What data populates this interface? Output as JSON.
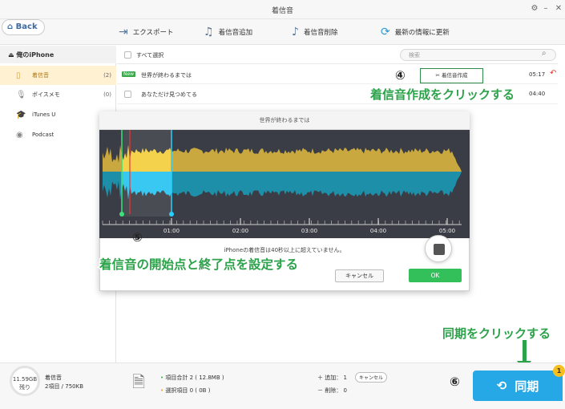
{
  "window": {
    "title": "着信音"
  },
  "toolbar": {
    "back_label": "Back",
    "export_label": "エクスポート",
    "add_label": "着信音追加",
    "delete_label": "着信音削除",
    "refresh_label": "最新の情報に更新"
  },
  "sidebar": {
    "device": "俺のiPhone",
    "items": [
      {
        "label": "着信音",
        "count": "(2)"
      },
      {
        "label": "ボイスメモ",
        "count": "(0)"
      },
      {
        "label": "iTunes U",
        "count": ""
      },
      {
        "label": "Podcast",
        "count": ""
      }
    ]
  },
  "list": {
    "select_all": "すべて選択",
    "search_placeholder": "検索",
    "rows": [
      {
        "badge": "New",
        "title": "世界が終わるまでは",
        "duration": "05:17"
      },
      {
        "badge": "",
        "title": "あなただけ見つめてる",
        "duration": "04:40"
      }
    ],
    "ringtone_button": "着信音作成"
  },
  "annotations": {
    "step4_num": "④",
    "step4": "着信音作成をクリックする",
    "step5_num": "⑤",
    "step5": "着信音の開始点と終了点を設定する",
    "step6_num": "⑥",
    "step6": "同期をクリックする"
  },
  "dialog": {
    "title": "世界が終わるまでは",
    "ticks": [
      "01:00",
      "02:00",
      "03:00",
      "04:00",
      "05:00"
    ],
    "message": "iPhoneの着信音は40秒以上に超えていません。",
    "cancel_label": "キャンセル",
    "ok_label": "OK",
    "colors": {
      "bg": "#3a3d45",
      "selected_top": "#f5cf3c",
      "selected_bottom": "#28c4f0",
      "top": "#c9a93f",
      "bottom": "#1e8fa9"
    }
  },
  "bottom": {
    "storage_size": "11.59GB",
    "storage_label": "残り",
    "category": "着信音",
    "category_detail": "2項目 / 750KB",
    "total": "項目合計 2 ( 12.8MB )",
    "selected": "選択項目 0 ( 0B )",
    "add": "＋ 追加： 1",
    "cancel": "キャンセル",
    "remove": "－ 削除： 0",
    "sync_label": "同期",
    "sync_badge": "1"
  }
}
